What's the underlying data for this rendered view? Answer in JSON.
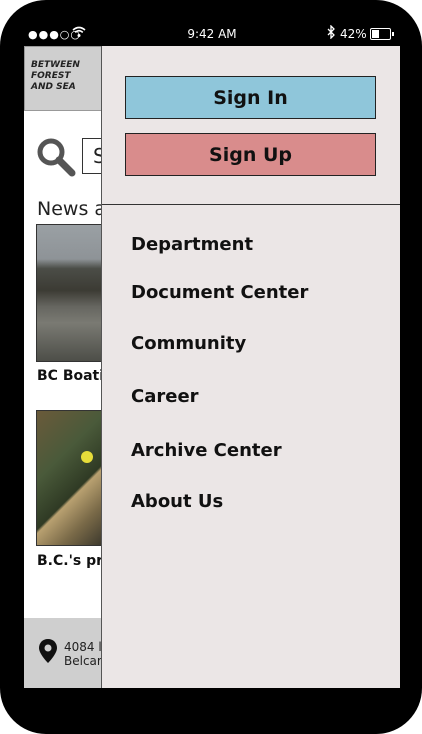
{
  "status_bar": {
    "signal": "●●●○○",
    "time": "9:42 AM",
    "battery": "42%",
    "battery_level": 0.42
  },
  "page": {
    "logo_lines": [
      "BETWEEN",
      "FOREST",
      "AND SEA"
    ],
    "search": {
      "value": "S"
    },
    "news_heading": "News a",
    "news": [
      {
        "title": "BC Boatin"
      },
      {
        "title": "B.C.'s pro"
      }
    ],
    "footer": {
      "address_line1": "4084 l",
      "address_line2": "Belcar"
    }
  },
  "drawer": {
    "sign_in_label": "Sign In",
    "sign_up_label": "Sign Up",
    "sign_in_color": "#8fc6da",
    "sign_up_color": "#d98c8c",
    "menu": [
      {
        "label": "Department"
      },
      {
        "label": "Document Center"
      },
      {
        "label": "Community"
      },
      {
        "label": "Career"
      },
      {
        "label": "Archive Center"
      },
      {
        "label": "About Us"
      }
    ]
  }
}
